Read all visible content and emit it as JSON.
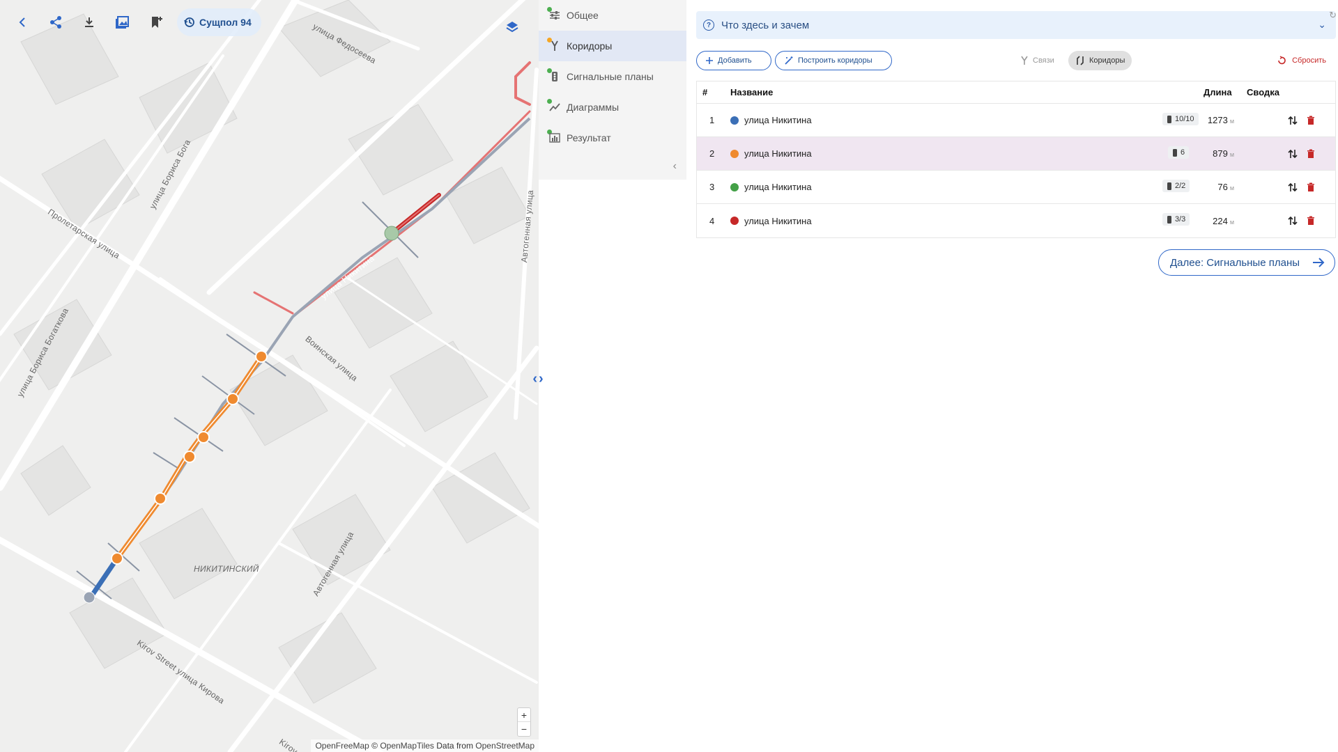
{
  "map": {
    "scenario_label": "Сущпол 94",
    "streets": [
      {
        "name": "улица Федосеева"
      },
      {
        "name": "улица Бориса Бога"
      },
      {
        "name": "Пролетарская улица"
      },
      {
        "name": "улица Бориса Богаткова"
      },
      {
        "name": "улица Никитина"
      },
      {
        "name": "Воинская улица"
      },
      {
        "name": "Автогенная улица"
      },
      {
        "name": "Автогенная улица"
      },
      {
        "name": "НИКИТИНСКИЙ"
      },
      {
        "name": "Kirov Street улица Кирова"
      },
      {
        "name": "Kirov St"
      }
    ],
    "zoom_in": "+",
    "zoom_out": "−",
    "attribution": {
      "part1": "OpenFreeMap",
      "part2": " © ",
      "part3": "OpenMapTiles",
      "part4": " Data from ",
      "part5": "OpenStreetMap"
    }
  },
  "sidebar": {
    "items": [
      {
        "label": "Общее",
        "icon": "sliders-icon",
        "dot_color": "#4caf50"
      },
      {
        "label": "Коридоры",
        "icon": "fork-icon",
        "dot_color": "#f5a623"
      },
      {
        "label": "Сигнальные планы",
        "icon": "traffic-light-icon",
        "dot_color": "#4caf50"
      },
      {
        "label": "Диаграммы",
        "icon": "chart-line-icon",
        "dot_color": "#4caf50"
      },
      {
        "label": "Результат",
        "icon": "bar-chart-icon",
        "dot_color": "#4caf50"
      }
    ],
    "collapse_glyph": "‹"
  },
  "main": {
    "help_title": "Что здесь и зачем",
    "add_label": "Добавить",
    "build_label": "Построить коридоры",
    "toggle_links": "Связи",
    "toggle_corridors": "Коридоры",
    "reset_label": "Сбросить",
    "table": {
      "headers": {
        "num": "#",
        "name": "Название",
        "length": "Длина",
        "summary": "Сводка"
      },
      "rows": [
        {
          "num": "1",
          "name": "улица Никитина",
          "color": "#3b6fb6",
          "badge": "10/10",
          "length": "1273",
          "unit": "м"
        },
        {
          "num": "2",
          "name": "улица Никитина",
          "color": "#ef8a2f",
          "badge": "6",
          "length": "879",
          "unit": "м"
        },
        {
          "num": "3",
          "name": "улица Никитина",
          "color": "#43a047",
          "badge": "2/2",
          "length": "76",
          "unit": "м"
        },
        {
          "num": "4",
          "name": "улица Никитина",
          "color": "#c62828",
          "badge": "3/3",
          "length": "224",
          "unit": "м"
        }
      ]
    },
    "next_label": "Далее: Сигнальные планы"
  },
  "colors": {
    "accent": "#2f67c8",
    "danger": "#c62828",
    "corridor_orange": "#ef8a2f",
    "corridor_blue": "#3b6fb6",
    "corridor_red": "#c62828"
  }
}
